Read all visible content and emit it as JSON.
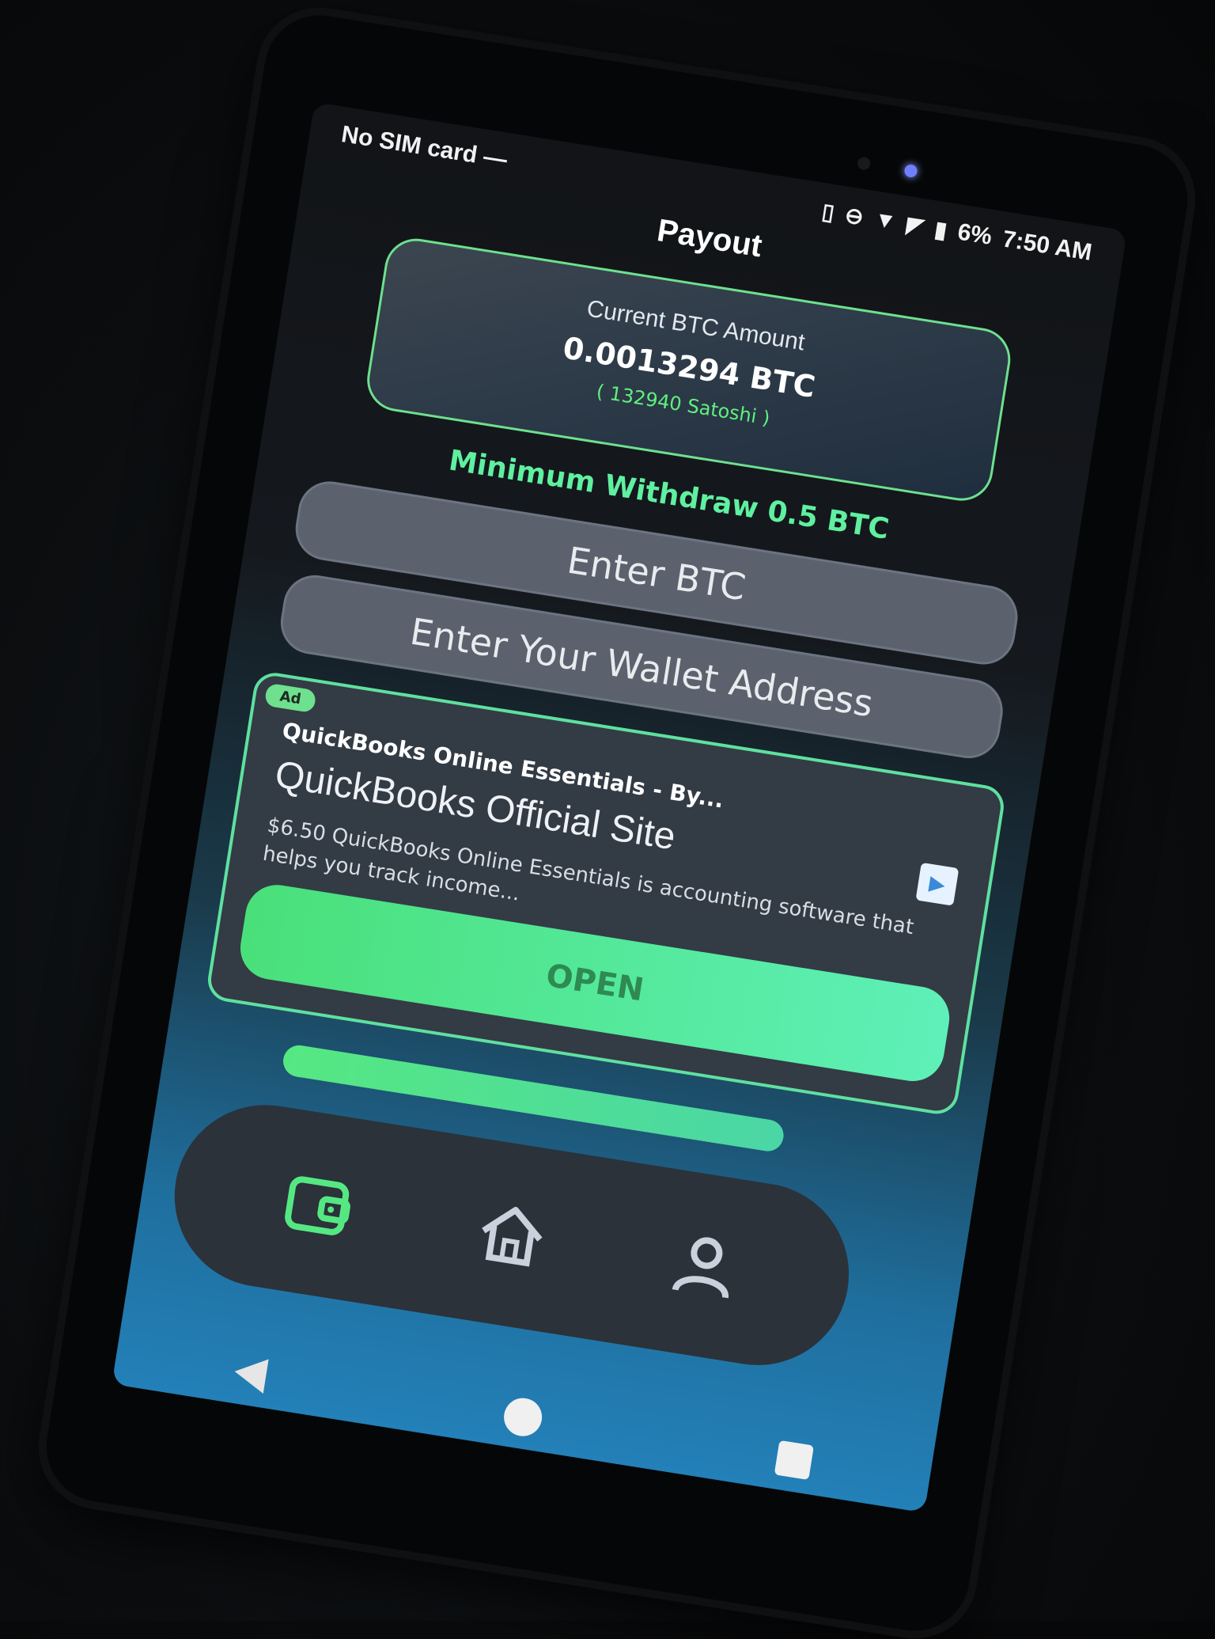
{
  "status_bar": {
    "carrier": "No SIM card —",
    "battery": "6%",
    "time": "7:50 AM",
    "icons": [
      "vibrate-icon",
      "dnd-icon",
      "wifi-icon",
      "no-signal-icon",
      "battery-icon"
    ]
  },
  "header": {
    "title": "Payout"
  },
  "balance": {
    "label": "Current BTC Amount",
    "amount": "0.0013294 BTC",
    "satoshi": "( 132940 Satoshi )"
  },
  "withdraw": {
    "minimum_text": "Minimum Withdraw 0.5 BTC"
  },
  "form": {
    "btc_placeholder": "Enter BTC",
    "wallet_placeholder": "Enter Your Wallet Address"
  },
  "ad": {
    "badge": "Ad",
    "headline": "QuickBooks Online Essentials - By...",
    "title": "QuickBooks Official Site",
    "description": "$6.50 QuickBooks Online Essentials is accounting software that helps you track income...",
    "button_label": "OPEN"
  },
  "progress": {
    "fraction": 1.0
  },
  "bottom_nav": {
    "items": [
      {
        "name": "wallet",
        "icon": "wallet-icon",
        "active": true
      },
      {
        "name": "home",
        "icon": "home-icon",
        "active": false
      },
      {
        "name": "profile",
        "icon": "user-icon",
        "active": false
      }
    ]
  },
  "colors": {
    "accent": "#5ff07e",
    "card_border": "#6ee08e",
    "screen_bottom": "#2380b8"
  }
}
